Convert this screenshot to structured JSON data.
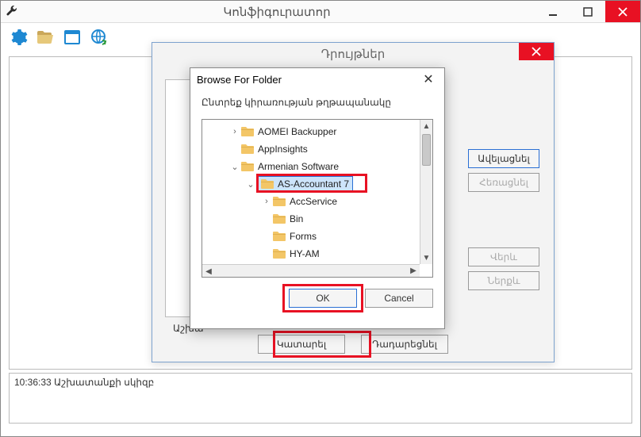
{
  "main": {
    "title": "Կոնֆիգուրատոր",
    "toolbar_icons": {
      "settings": "gear-icon",
      "open": "folder-open-icon",
      "window": "window-icon",
      "web": "globe-refresh-icon"
    }
  },
  "status": {
    "line1": "10:36:33 Աշխատանքի սկիզբ"
  },
  "mid_dialog": {
    "title": "Դրույթներ",
    "right_buttons": {
      "add": "Ավելացնել",
      "remove": "Հեռացնել",
      "up": "Վերև",
      "down": "Ներքև"
    },
    "work_label_prefix": "Աշխա",
    "execute": "Կատարել",
    "cancel": "Դադարեցնել"
  },
  "browse": {
    "title": "Browse For Folder",
    "instruction": "Ընտրեք կիրառության թղթապանակը",
    "ok": "OK",
    "cancel": "Cancel",
    "tree": {
      "items": [
        {
          "depth": 0,
          "expander": "›",
          "label": "AOMEI Backupper",
          "selected": false
        },
        {
          "depth": 0,
          "expander": "",
          "label": "AppInsights",
          "selected": false
        },
        {
          "depth": 0,
          "expander": "⌄",
          "label": "Armenian Software",
          "selected": false
        },
        {
          "depth": 1,
          "expander": "⌄",
          "label": "AS-Accountant 7",
          "selected": true
        },
        {
          "depth": 2,
          "expander": "›",
          "label": "AccService",
          "selected": false
        },
        {
          "depth": 2,
          "expander": "",
          "label": "Bin",
          "selected": false
        },
        {
          "depth": 2,
          "expander": "",
          "label": "Forms",
          "selected": false
        },
        {
          "depth": 2,
          "expander": "",
          "label": "HY-AM",
          "selected": false
        }
      ]
    }
  }
}
